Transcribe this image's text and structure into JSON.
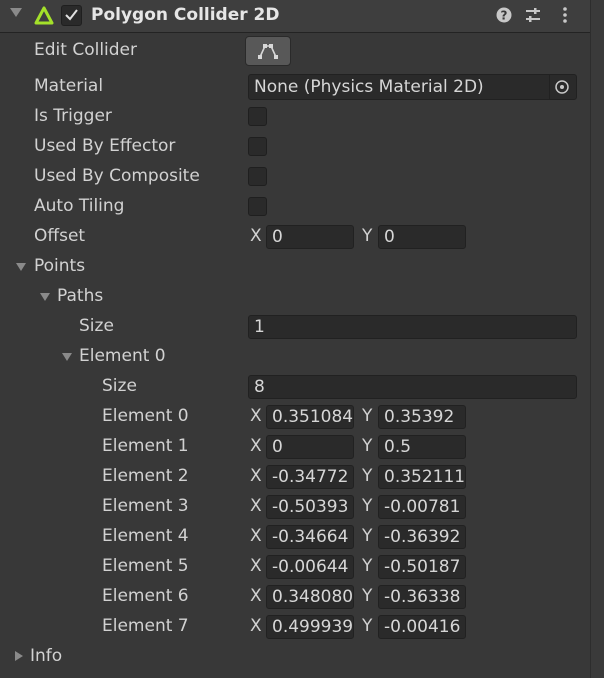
{
  "header": {
    "title": "Polygon Collider 2D",
    "enabled": true,
    "component_icon": "polygon-collider-icon"
  },
  "icons": {
    "help": "help-icon",
    "presets": "sliders-icon",
    "menu": "kebab-menu-icon",
    "edit_collider": "edit-shape-icon",
    "picker": "object-picker-icon"
  },
  "fields": {
    "edit_collider": {
      "label": "Edit Collider"
    },
    "material": {
      "label": "Material",
      "value": "None (Physics Material 2D)"
    },
    "is_trigger": {
      "label": "Is Trigger",
      "checked": false
    },
    "used_by_effector": {
      "label": "Used By Effector",
      "checked": false
    },
    "used_by_composite": {
      "label": "Used By Composite",
      "checked": false
    },
    "auto_tiling": {
      "label": "Auto Tiling",
      "checked": false
    },
    "offset": {
      "label": "Offset",
      "x_label": "X",
      "y_label": "Y",
      "x": "0",
      "y": "0"
    }
  },
  "points": {
    "label": "Points",
    "paths": {
      "label": "Paths",
      "size_label": "Size",
      "size": "1",
      "element0": {
        "label": "Element 0",
        "size_label": "Size",
        "size": "8",
        "elements": [
          {
            "label": "Element 0",
            "x": "0.351084",
            "y": "0.35392"
          },
          {
            "label": "Element 1",
            "x": "0",
            "y": "0.5"
          },
          {
            "label": "Element 2",
            "x": "-0.34772",
            "y": "0.352111"
          },
          {
            "label": "Element 3",
            "x": "-0.50393",
            "y": "-0.00781"
          },
          {
            "label": "Element 4",
            "x": "-0.34664",
            "y": "-0.36392"
          },
          {
            "label": "Element 5",
            "x": "-0.00644",
            "y": "-0.50187"
          },
          {
            "label": "Element 6",
            "x": "0.348080",
            "y": "-0.36338"
          },
          {
            "label": "Element 7",
            "x": "0.499939",
            "y": "-0.00416"
          }
        ]
      }
    }
  },
  "info": {
    "label": "Info"
  },
  "colors": {
    "accent_icon": "#a4e12a",
    "background": "#383838",
    "field": "#2a2a2a"
  }
}
